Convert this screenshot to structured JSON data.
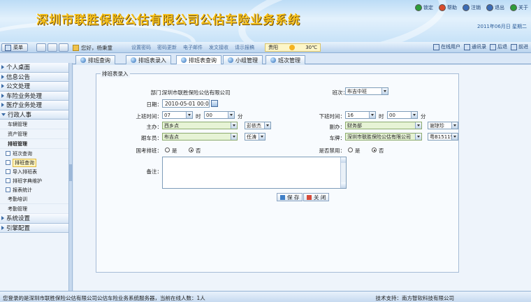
{
  "header": {
    "system_title": "深圳市联胜保险公估有限公司公估车险业务系统",
    "top_links": [
      {
        "label": "锁定",
        "icon": "lock-icon",
        "color": "#2e9d3a"
      },
      {
        "label": "帮助",
        "icon": "help-icon",
        "color": "#d94b2b"
      },
      {
        "label": "注销",
        "icon": "logout-icon",
        "color": "#3b6cb5"
      },
      {
        "label": "退出",
        "icon": "exit-icon",
        "color": "#3b6cb5"
      },
      {
        "label": "关于",
        "icon": "about-icon",
        "color": "#2e9d3a"
      }
    ],
    "date_text": "2011年06月日 星期二"
  },
  "toolbar": {
    "menu_label": "菜单",
    "welcome": "您好，杨秉童",
    "quick_links": [
      "设置密码",
      "密码更新",
      "电子邮件",
      "发文接收",
      "请示报稿"
    ],
    "weather_city": "贵阳",
    "weather_temp": "30℃",
    "right_tools": [
      "在线用户",
      "通讯录",
      "后退",
      "前进"
    ]
  },
  "sidebar": {
    "items_top": [
      {
        "label": "个人桌面"
      },
      {
        "label": "信息公告"
      },
      {
        "label": "公文处理"
      },
      {
        "label": "车险业务处理"
      },
      {
        "label": "医疗业务处理"
      }
    ],
    "admin": {
      "label": "行政人事",
      "subs": [
        "车辆管理",
        "资产管理",
        "排班管理"
      ],
      "leaves": [
        "班次查询",
        "排班查询",
        "导入排班表",
        "排班字典维护",
        "报表统计"
      ],
      "subs_after": [
        "考勤培训",
        "考勤管理"
      ]
    },
    "items_bottom": [
      {
        "label": "系统设置"
      },
      {
        "label": "引擎配置"
      }
    ]
  },
  "tabs": [
    "排班查询",
    "排班表录入",
    "排班表查询",
    "小组管理",
    "班次管理"
  ],
  "form": {
    "legend": "排班表录入",
    "dept_label": "部门：",
    "dept_value": "深圳市联胜保险公估有限公司",
    "shift_label": "班次：",
    "shift_value": "布吉中班",
    "date_label": "日期：",
    "date_value": "2010-05-01 00:0",
    "start_label": "上班时间：",
    "start_hour": "07",
    "hour_unit": "时",
    "start_min": "00",
    "min_unit": "分",
    "end_label": "下班时间：",
    "end_hour": "16",
    "end_min": "00",
    "lead_label": "主办：",
    "lead_value": "西乡点",
    "lead_person": "彭依杰",
    "deputy_label": "副办：",
    "deputy_value": "财务部",
    "deputy_person": "谢琼珍",
    "follower_label": "跟车员：",
    "follower_value": "布吉点",
    "follower_person": "任涛",
    "plate_label": "车牌：",
    "plate_company": "深圳市联胜保险公估有限公司",
    "plate_value": "粤B1511S",
    "holiday_label": "国考排班：",
    "yes_label": "是",
    "no_label": "否",
    "disabled_label": "是否禁用：",
    "remark_label": "备注：",
    "save_label": "保 存",
    "close_label": "关 闭"
  },
  "status": {
    "left_text": "您登录的是深圳市联胜保险公估有限公司公估车险业务系统服务器，当前在线人数：1人",
    "right_text": "技术支持：南方智软科技有限公司"
  }
}
